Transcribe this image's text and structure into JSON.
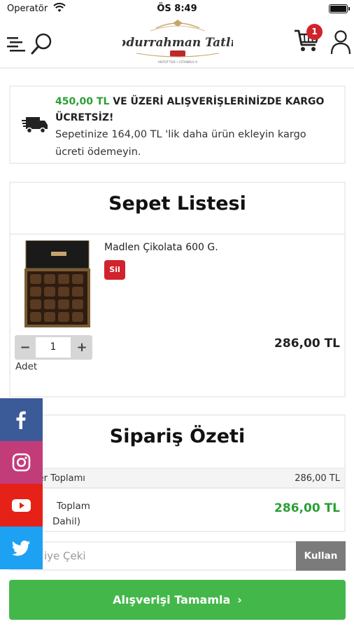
{
  "status_bar": {
    "carrier": "Operatör",
    "time": "ÖS 8:49"
  },
  "header": {
    "logo_text": "Abdurrahman Tatlıcı",
    "logo_tagline": "ANTEP'TEN • ISTANBUL'A",
    "cart_count": "1"
  },
  "shipping": {
    "threshold": "450,00 TL",
    "headline_line1": " VE ÜZERİ ALIŞVERİŞLERİNİZDE KARGO",
    "headline_line2": "ÜCRETSİZ!",
    "message_line1": "Sepetinize 164,00 TL 'lik daha ürün ekleyin kargo",
    "message_line2": "ücreti ödemeyin."
  },
  "cart": {
    "title": "Sepet Listesi",
    "item": {
      "name": "Madlen Çikolata 600 G.",
      "remove_label": "Sil",
      "quantity": "1",
      "quantity_label": "Adet",
      "price": "286,00 TL"
    }
  },
  "summary": {
    "title": "Sipariş Özeti",
    "subtotal_label": "ler Toplamı",
    "subtotal_value": "286,00 TL",
    "total_label_line1": "Toplam",
    "total_label_line2": "Dahil)",
    "total_value": "286,00 TL"
  },
  "coupon": {
    "placeholder": "iye Çeki",
    "button_label": "Kullan"
  },
  "checkout": {
    "button_label": "Alışverişi Tamamla",
    "chevron": "›"
  },
  "colors": {
    "accent_green": "#44b74b",
    "price_green": "#2b9f34",
    "danger_red": "#d0232b",
    "facebook": "#3b5a98",
    "instagram": "#c33c7a",
    "youtube": "#e62117",
    "twitter": "#1da1f2"
  },
  "icons": {
    "menu": "menu-icon",
    "search": "search-icon",
    "cart": "cart-icon",
    "user": "user-icon",
    "truck": "truck-icon",
    "social": [
      "facebook-icon",
      "instagram-icon",
      "youtube-icon",
      "twitter-icon"
    ]
  }
}
